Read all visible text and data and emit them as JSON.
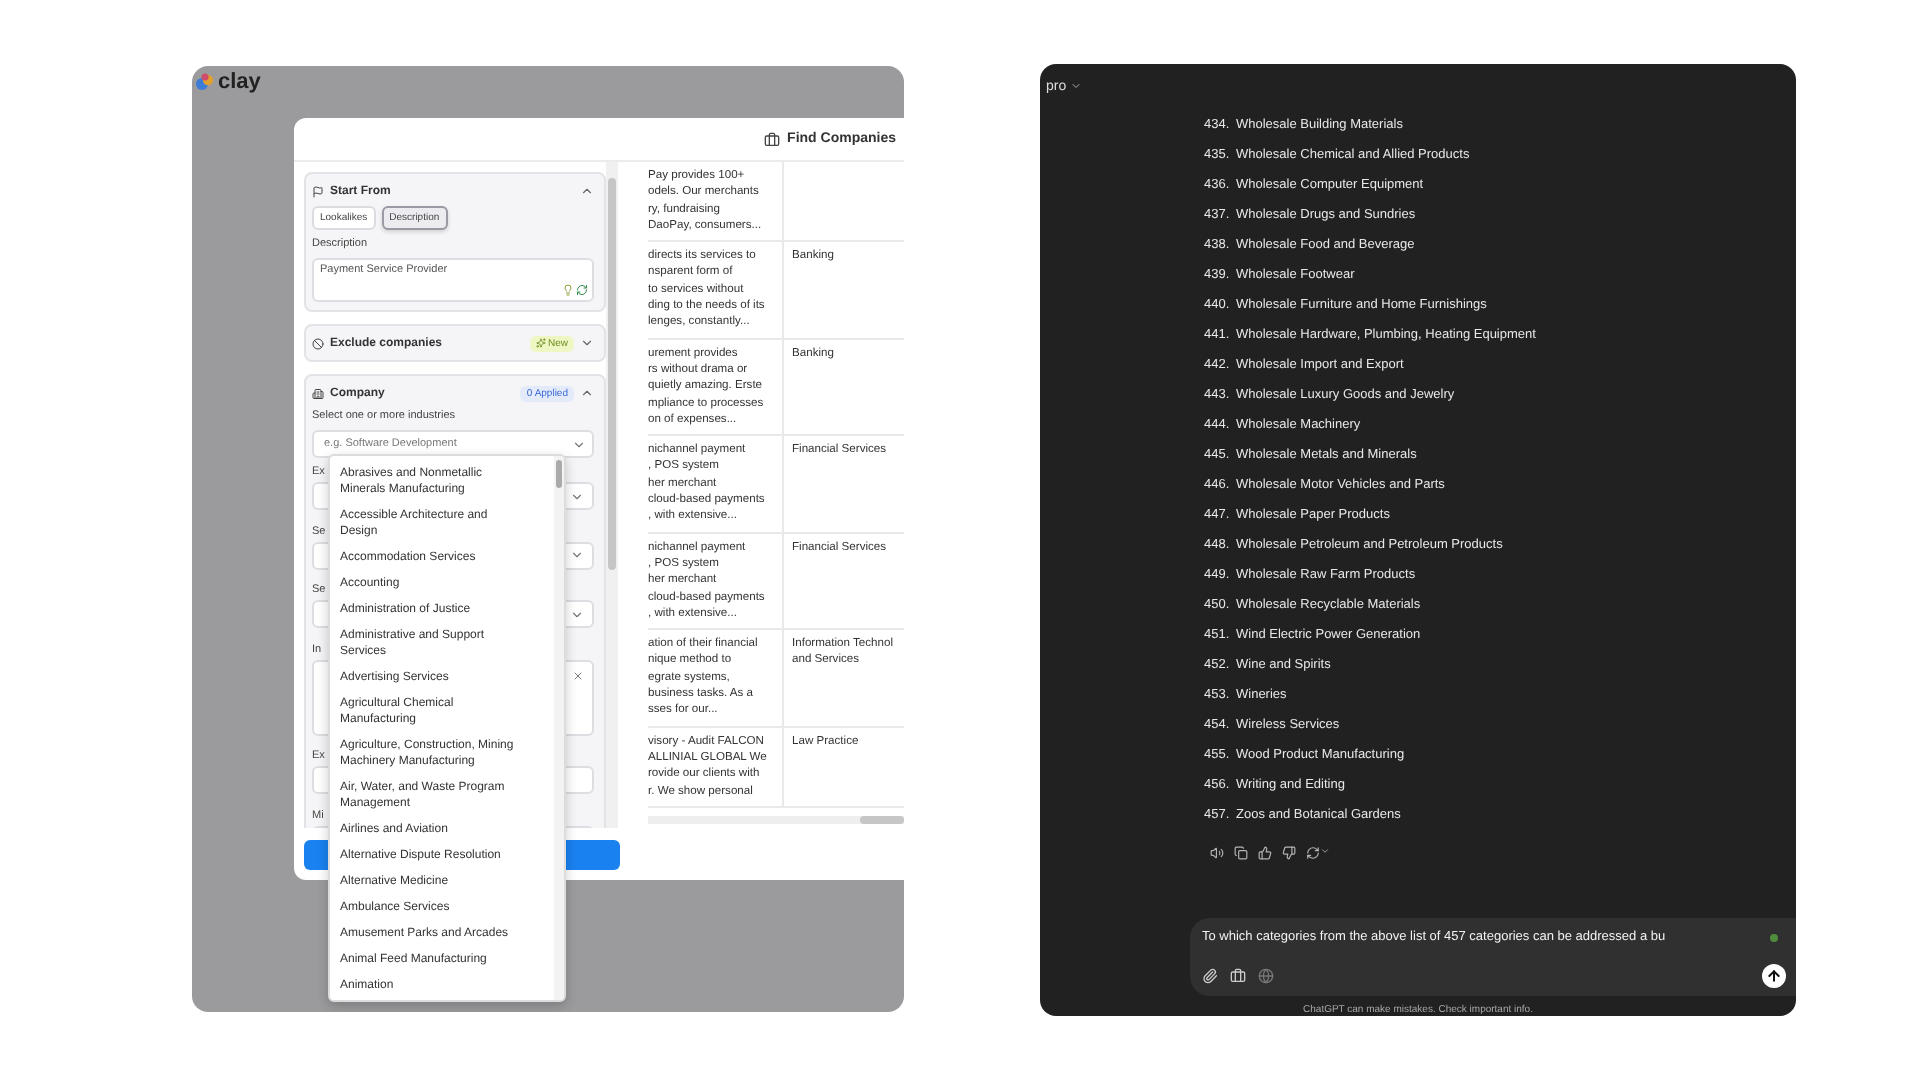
{
  "left_window": {
    "logo": "clay",
    "card": {
      "title": "Find Companies",
      "start_from": {
        "title": "Start From",
        "expanded": true,
        "tabs": [
          {
            "label": "Lookalikes",
            "selected": false
          },
          {
            "label": "Description",
            "selected": true
          }
        ],
        "description_label": "Description",
        "description_value": "Payment Service Provider"
      },
      "exclude": {
        "title": "Exclude companies",
        "badge": "New",
        "expanded": false
      },
      "company": {
        "title": "Company",
        "badge": "0 Applied",
        "expanded": true,
        "industries_label": "Select one or more industries",
        "industries_placeholder": "e.g. Software Development",
        "fields": [
          {
            "label": "Ex",
            "kind": "select"
          },
          {
            "label": "Se",
            "kind": "multiselect"
          },
          {
            "label": "Se",
            "kind": "select"
          },
          {
            "label": "In",
            "kind": "textarea"
          },
          {
            "label": "Ex",
            "kind": "input"
          },
          {
            "label": "Mi",
            "kind": "input"
          }
        ]
      },
      "dropdown": {
        "items": [
          "Abrasives and Nonmetallic Minerals Manufacturing",
          "Accessible Architecture and Design",
          "Accommodation Services",
          "Accounting",
          "Administration of Justice",
          "Administrative and Support Services",
          "Advertising Services",
          "Agricultural Chemical Manufacturing",
          "Agriculture, Construction, Mining Machinery Manufacturing",
          "Air, Water, and Waste Program Management",
          "Airlines and Aviation",
          "Alternative Dispute Resolution",
          "Alternative Medicine",
          "Ambulance Services",
          "Amusement Parks and Arcades",
          "Animal Feed Manufacturing",
          "Animation"
        ]
      },
      "table": {
        "rows": [
          {
            "column_1": "Pay provides 100+\nodels. Our merchants\nry, fundraising\nDaoPay, consumers...",
            "column_2": ""
          },
          {
            "column_1": "directs its services to\nnsparent form of\nto services without\nding to the needs of its\nlenges, constantly...",
            "column_2": "Banking"
          },
          {
            "column_1": "urement provides\nrs without drama or\nquietly amazing. Erste\nmpliance to processes\non of expenses...",
            "column_2": "Banking"
          },
          {
            "column_1": "nichannel payment\n, POS system\nher merchant\ncloud-based payments\n, with extensive...",
            "column_2": "Financial Services"
          },
          {
            "column_1": "nichannel payment\n, POS system\nher merchant\ncloud-based payments\n, with extensive...",
            "column_2": "Financial Services"
          },
          {
            "column_1": "ation of their financial\nnique method to\negrate systems,\nbusiness tasks. As a\nsses for our...",
            "column_2": "Information Technol\nand Services"
          },
          {
            "column_1": "visory - Audit FALCON\nALLINIAL GLOBAL We\nrovide our clients with\nr. We show personal",
            "column_2": "Law Practice"
          }
        ]
      }
    }
  },
  "chat_window": {
    "model": "pro",
    "list": [
      {
        "number": "434.",
        "text": "Wholesale Building Materials"
      },
      {
        "number": "435.",
        "text": "Wholesale Chemical and Allied Products"
      },
      {
        "number": "436.",
        "text": "Wholesale Computer Equipment"
      },
      {
        "number": "437.",
        "text": "Wholesale Drugs and Sundries"
      },
      {
        "number": "438.",
        "text": "Wholesale Food and Beverage"
      },
      {
        "number": "439.",
        "text": "Wholesale Footwear"
      },
      {
        "number": "440.",
        "text": "Wholesale Furniture and Home Furnishings"
      },
      {
        "number": "441.",
        "text": "Wholesale Hardware, Plumbing, Heating Equipment"
      },
      {
        "number": "442.",
        "text": "Wholesale Import and Export"
      },
      {
        "number": "443.",
        "text": "Wholesale Luxury Goods and Jewelry"
      },
      {
        "number": "444.",
        "text": "Wholesale Machinery"
      },
      {
        "number": "445.",
        "text": "Wholesale Metals and Minerals"
      },
      {
        "number": "446.",
        "text": "Wholesale Motor Vehicles and Parts"
      },
      {
        "number": "447.",
        "text": "Wholesale Paper Products"
      },
      {
        "number": "448.",
        "text": "Wholesale Petroleum and Petroleum Products"
      },
      {
        "number": "449.",
        "text": "Wholesale Raw Farm Products"
      },
      {
        "number": "450.",
        "text": "Wholesale Recyclable Materials"
      },
      {
        "number": "451.",
        "text": "Wind Electric Power Generation"
      },
      {
        "number": "452.",
        "text": "Wine and Spirits"
      },
      {
        "number": "453.",
        "text": "Wineries"
      },
      {
        "number": "454.",
        "text": "Wireless Services"
      },
      {
        "number": "455.",
        "text": "Wood Product Manufacturing"
      },
      {
        "number": "456.",
        "text": "Writing and Editing"
      },
      {
        "number": "457.",
        "text": "Zoos and Botanical Gardens"
      }
    ],
    "composer": {
      "value": "To which categories from the above list of 457 categories can be addressed a bu"
    },
    "footer": "ChatGPT can make mistakes. Check important info."
  }
}
